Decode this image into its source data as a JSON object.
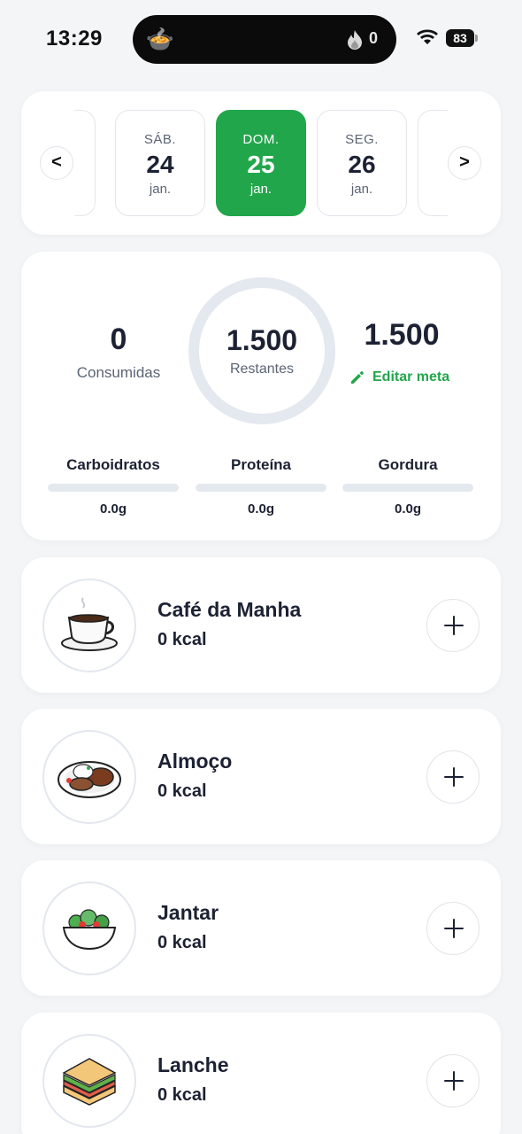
{
  "status_bar": {
    "time": "13:29",
    "flame_count": "0",
    "battery": "83"
  },
  "date_selector": {
    "prev_label": "<",
    "next_label": ">",
    "days": [
      {
        "weekday": "SÁB.",
        "day": "24",
        "month": "jan."
      },
      {
        "weekday": "DOM.",
        "day": "25",
        "month": "jan.",
        "selected": true
      },
      {
        "weekday": "SEG.",
        "day": "26",
        "month": "jan."
      }
    ]
  },
  "summary": {
    "consumed_value": "0",
    "consumed_label": "Consumidas",
    "remaining_value": "1.500",
    "remaining_label": "Restantes",
    "goal_value": "1.500",
    "edit_goal_label": "Editar meta",
    "macros": [
      {
        "name": "Carboidratos",
        "value": "0.0g",
        "progress": 0
      },
      {
        "name": "Proteína",
        "value": "0.0g",
        "progress": 0
      },
      {
        "name": "Gordura",
        "value": "0.0g",
        "progress": 0
      }
    ]
  },
  "meals": [
    {
      "name": "Café da Manha",
      "kcal": "0 kcal",
      "icon": "coffee-cup-icon"
    },
    {
      "name": "Almoço",
      "kcal": "0 kcal",
      "icon": "lunch-plate-icon"
    },
    {
      "name": "Jantar",
      "kcal": "0 kcal",
      "icon": "salad-bowl-icon"
    },
    {
      "name": "Lanche",
      "kcal": "0 kcal",
      "icon": "sandwich-icon"
    }
  ],
  "colors": {
    "accent": "#22a64b",
    "text": "#1c2233",
    "muted": "#5b6475",
    "track": "#e4e8ef"
  }
}
